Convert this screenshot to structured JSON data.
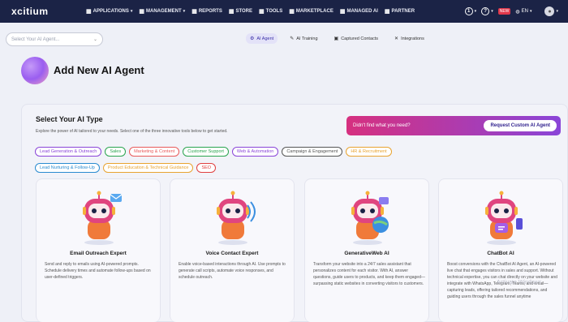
{
  "brand": "xcitium",
  "nav": {
    "items": [
      {
        "label": "APPLICATIONS",
        "icon": "grid-icon",
        "caret": true
      },
      {
        "label": "MANAGEMENT",
        "icon": "gear-icon",
        "caret": true
      },
      {
        "label": "REPORTS",
        "icon": "report-icon",
        "caret": false
      },
      {
        "label": "STORE",
        "icon": "store-icon",
        "caret": false
      },
      {
        "label": "TOOLS",
        "icon": "tools-icon",
        "caret": false
      },
      {
        "label": "MARKETPLACE",
        "icon": "marketplace-icon",
        "caret": false
      },
      {
        "label": "MANAGED AI",
        "icon": "managed-ai-icon",
        "caret": false
      },
      {
        "label": "PARTNER",
        "icon": "partner-icon",
        "caret": false
      }
    ],
    "right": {
      "notif_count": "1",
      "help": "?",
      "badge": "NEW",
      "lang": "EN"
    }
  },
  "subbar": {
    "select_placeholder": "Select Your AI Agent...",
    "tabs": [
      {
        "label": "AI Agent",
        "icon": "agent-icon",
        "active": true
      },
      {
        "label": "AI Training",
        "icon": "training-icon",
        "active": false
      },
      {
        "label": "Captured Contacts",
        "icon": "contacts-icon",
        "active": false
      },
      {
        "label": "Integrations",
        "icon": "integrations-icon",
        "active": false
      }
    ]
  },
  "page": {
    "title": "Add New AI Agent"
  },
  "section": {
    "title": "Select Your AI Type",
    "description": "Explore the power of AI tailored to your needs. Select one of the three innovative tools below to get started.",
    "banner_text": "Didn't find what you need?",
    "banner_button": "Request Custom AI Agent"
  },
  "categories": [
    {
      "label": "Lead Generation & Outreach",
      "color": "#8a45d8"
    },
    {
      "label": "Sales",
      "color": "#2aa44f"
    },
    {
      "label": "Marketing & Content",
      "color": "#e85a5a"
    },
    {
      "label": "Customer Support",
      "color": "#2aa44f"
    },
    {
      "label": "Web & Automation",
      "color": "#8a45d8"
    },
    {
      "label": "Campaign & Engagement",
      "color": "#555555"
    },
    {
      "label": "HR & Recruitment",
      "color": "#e8a330"
    },
    {
      "label": "Lead Nurturing & Follow-Up",
      "color": "#2a8bd0"
    },
    {
      "label": "Product Education & Technical Guidance",
      "color": "#e8a330"
    },
    {
      "label": "SEO",
      "color": "#e04040"
    }
  ],
  "cards": [
    {
      "title": "Email Outreach Expert",
      "icon": "email-robot-icon",
      "description": "Send and reply to emails using AI-powered prompts. Schedule delivery times and automate follow-ups based on user-defined triggers."
    },
    {
      "title": "Voice Contact Expert",
      "icon": "voice-robot-icon",
      "description": "Enable voice-based interactions through AI. Use prompts to generate call scripts, automate voice responses, and schedule outreach."
    },
    {
      "title": "GenerativeWeb AI",
      "icon": "web-robot-icon",
      "description": "Transform your website into a 24/7 sales assistant that personalizes content for each visitor. With AI, answer questions, guide users to products, and keep them engaged—surpassing static websites in converting visitors to customers."
    },
    {
      "title": "ChatBot AI",
      "icon": "chat-robot-icon",
      "description": "Boost conversions with the ChatBot AI Agent, an AI-powered live chat that engages visitors in sales and support. Without technical expertise, you can chat directly on your website and integrate with WhatsApp, Telegram, Teams, and email—capturing leads, offering tailored recommendations, and guiding users through the sales funnel anytime"
    }
  ],
  "watermark": "Activate Windows"
}
